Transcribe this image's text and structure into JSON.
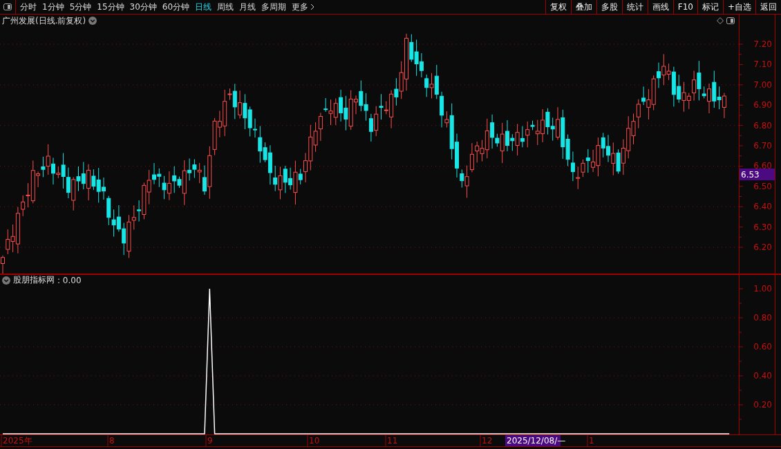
{
  "toolbar": {
    "tabs": [
      {
        "label": "分时",
        "selected": false
      },
      {
        "label": "1分钟",
        "selected": false
      },
      {
        "label": "5分钟",
        "selected": false
      },
      {
        "label": "15分钟",
        "selected": false
      },
      {
        "label": "30分钟",
        "selected": false
      },
      {
        "label": "60分钟",
        "selected": false
      },
      {
        "label": "日线",
        "selected": true
      },
      {
        "label": "周线",
        "selected": false
      },
      {
        "label": "月线",
        "selected": false
      },
      {
        "label": "多周期",
        "selected": false
      },
      {
        "label": "更多",
        "selected": false
      }
    ],
    "buttons": [
      "复权",
      "叠加",
      "多股",
      "统计",
      "画线",
      "F10",
      "标记",
      "+自选",
      "返回"
    ]
  },
  "price_pane": {
    "title": "广州发展(日线.前复权)",
    "axis_labels": [
      "7.20",
      "7.10",
      "7.00",
      "6.90",
      "6.80",
      "6.70",
      "6.60",
      "6.50",
      "6.40",
      "6.30",
      "6.20"
    ],
    "current_price": "6.53"
  },
  "indicator_pane": {
    "reading": ": 0.00",
    "chart_data": {
      "type": "line",
      "grid": true,
      "ylim": [
        0,
        1.024
      ],
      "yticks": [
        {
          "value": 0.2,
          "label": "0.20"
        },
        {
          "value": 0.4,
          "label": "0.40"
        },
        {
          "value": 0.6,
          "label": "0.60"
        },
        {
          "value": 0.8,
          "label": "0.80"
        },
        {
          "value": 1.0,
          "label": "1.00"
        }
      ],
      "series": [
        {
          "name": "股朋指标网",
          "color": "#ffffff",
          "values": [
            0,
            0,
            0,
            0,
            0,
            0,
            0,
            0,
            0,
            0,
            0,
            0,
            0,
            0,
            0,
            0,
            0,
            0,
            0,
            0,
            0,
            0,
            0,
            0,
            0,
            0,
            0,
            0,
            0,
            0,
            0,
            0,
            0,
            0,
            0,
            0,
            0,
            0,
            0,
            0,
            0,
            1,
            0,
            0,
            0,
            0,
            0,
            0,
            0,
            0,
            0,
            0,
            0,
            0,
            0,
            0,
            0,
            0,
            0,
            0,
            0,
            0,
            0,
            0,
            0,
            0,
            0,
            0,
            0,
            0,
            0,
            0,
            0,
            0,
            0,
            0,
            0,
            0,
            0,
            0,
            0,
            0,
            0,
            0,
            0,
            0,
            0,
            0,
            0,
            0,
            0,
            0,
            0,
            0,
            0,
            0,
            0,
            0,
            0,
            0,
            0,
            0,
            0,
            0,
            0,
            0,
            0,
            0,
            0,
            0,
            0,
            0,
            0,
            0,
            0,
            0,
            0,
            0,
            0,
            0,
            0,
            0,
            0,
            0,
            0,
            0,
            0,
            0,
            0,
            0,
            0,
            0,
            0,
            0,
            0,
            0,
            0,
            0,
            0,
            0,
            0,
            0,
            0,
            0,
            0
          ]
        }
      ]
    }
  },
  "x_axis": {
    "labels": [
      {
        "text": "2025年",
        "highlighted": false
      },
      {
        "text": "8",
        "highlighted": false
      },
      {
        "text": "9",
        "highlighted": false
      },
      {
        "text": "10",
        "highlighted": false
      },
      {
        "text": "11",
        "highlighted": false
      },
      {
        "text": "12",
        "highlighted": false
      },
      {
        "text": "2025/12/08/—",
        "highlighted": true
      },
      {
        "text": "1",
        "highlighted": false
      }
    ]
  }
}
